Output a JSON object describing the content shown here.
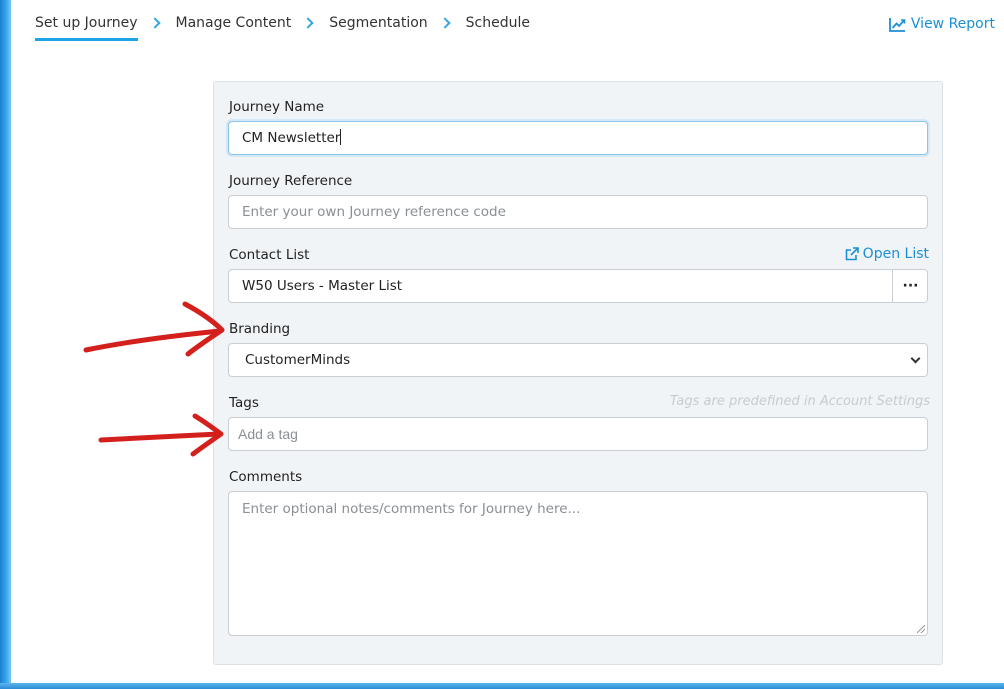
{
  "steps": [
    {
      "label": "Set up Journey",
      "active": true
    },
    {
      "label": "Manage Content",
      "active": false
    },
    {
      "label": "Segmentation",
      "active": false
    },
    {
      "label": "Schedule",
      "active": false
    }
  ],
  "header": {
    "view_report_label": "View Report",
    "view_report_icon": "line-chart-icon"
  },
  "form": {
    "journey_name": {
      "label": "Journey Name",
      "value": "CM Newsletter"
    },
    "journey_reference": {
      "label": "Journey Reference",
      "placeholder": "Enter your own Journey reference code"
    },
    "contact_list": {
      "label": "Contact List",
      "value": "W50 Users - Master List",
      "open_list_label": "Open List",
      "open_list_icon": "external-link-icon",
      "browse_label": "···"
    },
    "branding": {
      "label": "Branding",
      "selected": "CustomerMinds"
    },
    "tags": {
      "label": "Tags",
      "hint": "Tags are predefined in Account Settings",
      "placeholder": "Add a tag"
    },
    "comments": {
      "label": "Comments",
      "placeholder": "Enter optional notes/comments for Journey here..."
    }
  },
  "colors": {
    "accent": "#1ea5e8",
    "link": "#1a8fd8",
    "annotation_arrow": "#d4201c"
  }
}
